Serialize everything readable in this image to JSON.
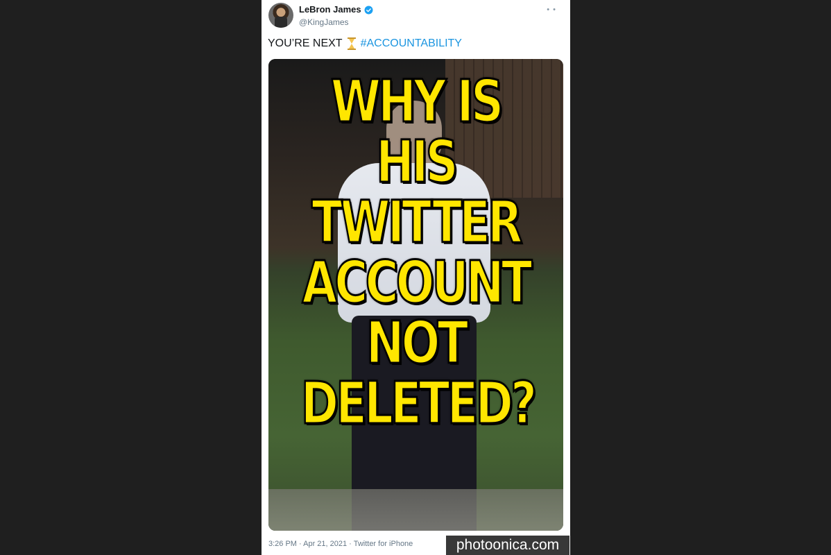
{
  "tweet": {
    "display_name": "LeBron James",
    "handle": "@KingJames",
    "more_icon": "more-dots-icon",
    "verified_icon": "verified-badge-icon",
    "text_main": "YOU’RE NEXT",
    "text_emoji": "hourglass-icon",
    "hashtag": "#ACCOUNTABILITY",
    "meta": "3:26 PM · Apr 21, 2021 · Twitter for iPhone",
    "verified_color": "#1da1f2",
    "hashtag_color": "#1b95e0"
  },
  "media": {
    "overlay_lines": [
      "WHY IS",
      "HIS",
      "TWITTER",
      "ACCOUNT",
      "NOT",
      "DELETED?"
    ],
    "overlay_color": "#ffe600"
  },
  "watermark": {
    "text": "photoonica.com"
  }
}
